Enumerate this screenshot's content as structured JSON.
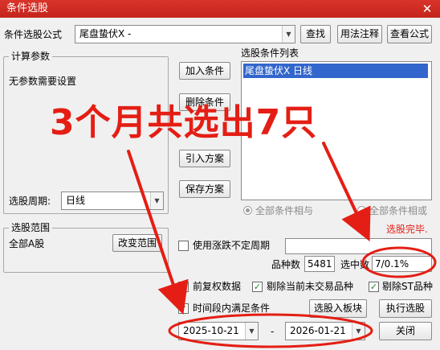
{
  "window": {
    "title": "条件选股",
    "close_glyph": "✕"
  },
  "formula_row": {
    "label": "条件选股公式",
    "combo_value": "尾盘蛰伏X  -",
    "find_button": "查找",
    "usage_button": "用法注释",
    "view_button": "查看公式"
  },
  "params": {
    "group_title": "计算参数",
    "message": "无参数需要设置"
  },
  "period": {
    "label": "选股周期:",
    "value": "日线"
  },
  "condition_buttons": {
    "add": "加入条件",
    "remove": "删除条件",
    "import": "引入方案",
    "save": "保存方案"
  },
  "condition_list": {
    "title": "选股条件列表",
    "items": [
      "尾盘蛰伏X  日线"
    ]
  },
  "logic": {
    "and_label": "全部条件相与",
    "or_label": "全部条件相或"
  },
  "status": {
    "done": "选股完毕."
  },
  "range": {
    "group_title": "选股范围",
    "value": "全部A股",
    "change_button": "改变范围"
  },
  "limit_period": {
    "label": "使用涨跌不定周期",
    "value": ""
  },
  "stats": {
    "count_label": "品种数",
    "count_value": "5481",
    "hit_label": "选中数",
    "hit_value": "7/0.1%"
  },
  "options": {
    "pre_adjust": "前复权数据",
    "exclude_untraded": "剔除当前未交易品种",
    "exclude_st": "剔除ST品种",
    "time_range": "时间段内满足条件",
    "check_glyph": "✓"
  },
  "dates": {
    "start": "2025-10-21",
    "separator": "-",
    "end": "2026-01-21"
  },
  "action_buttons": {
    "to_block": "选股入板块",
    "execute": "执行选股",
    "close": "关闭"
  },
  "annotation": {
    "text": "3个月共选出7只",
    "color": "#e41e14"
  }
}
